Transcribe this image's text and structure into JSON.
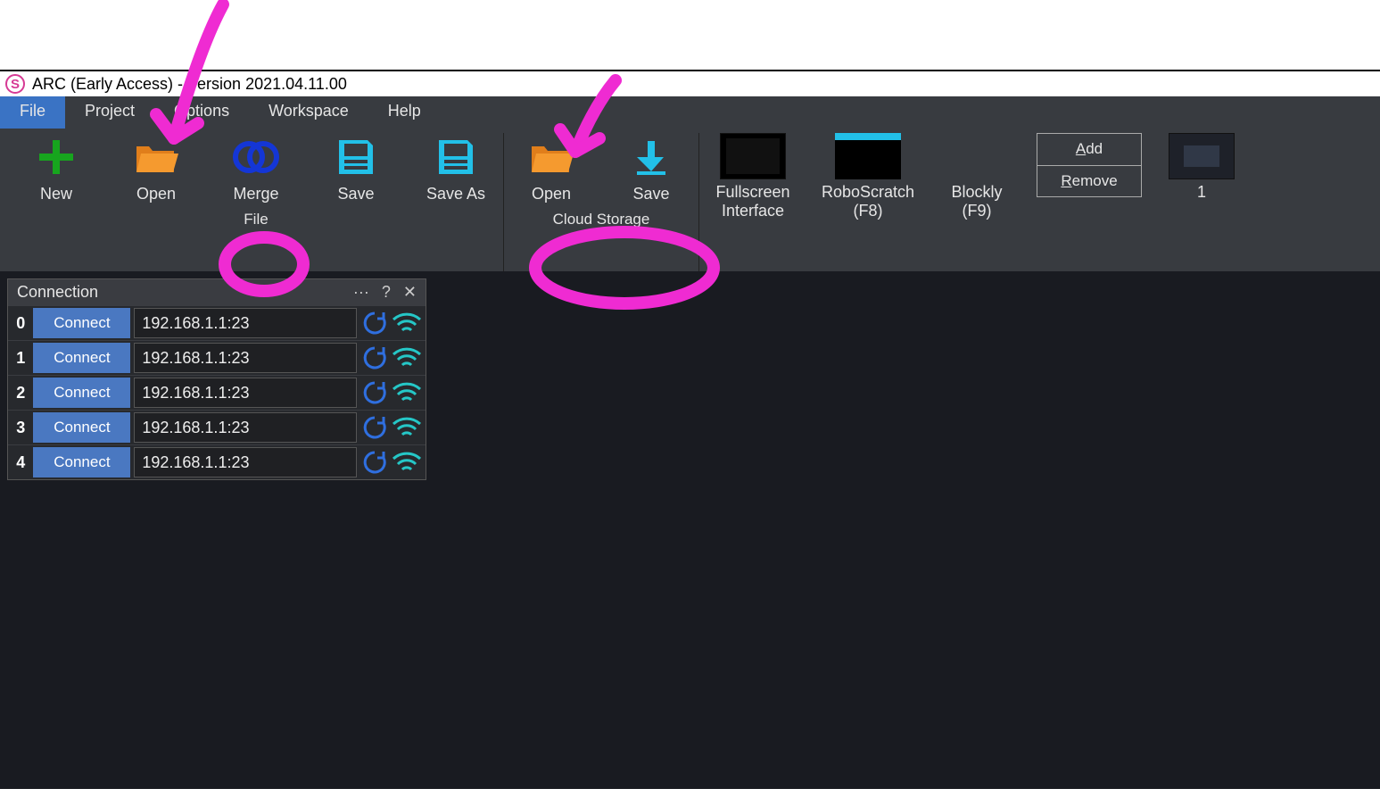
{
  "title": "ARC (Early Access) - Version 2021.04.11.00",
  "menu": {
    "file": "File",
    "project": "Project",
    "options": "Options",
    "workspace": "Workspace",
    "help": "Help"
  },
  "ribbon": {
    "file": {
      "label": "File",
      "new": "New",
      "open": "Open",
      "merge": "Merge",
      "save": "Save",
      "saveAs": "Save As"
    },
    "cloud": {
      "label": "Cloud Storage",
      "open": "Open",
      "save": "Save"
    },
    "views": {
      "fullscreen": "Fullscreen\nInterface",
      "roboscratch": "RoboScratch\n(F8)",
      "blockly": "Blockly\n(F9)"
    },
    "addRemove": {
      "add": "Add",
      "remove": "Remove"
    },
    "wsThumb": {
      "label": "1"
    }
  },
  "connection": {
    "title": "Connection",
    "more": "···",
    "help": "?",
    "close": "✕",
    "rows": [
      {
        "idx": "0",
        "btn": "Connect",
        "addr": "192.168.1.1:23"
      },
      {
        "idx": "1",
        "btn": "Connect",
        "addr": "192.168.1.1:23"
      },
      {
        "idx": "2",
        "btn": "Connect",
        "addr": "192.168.1.1:23"
      },
      {
        "idx": "3",
        "btn": "Connect",
        "addr": "192.168.1.1:23"
      },
      {
        "idx": "4",
        "btn": "Connect",
        "addr": "192.168.1.1:23"
      }
    ]
  }
}
